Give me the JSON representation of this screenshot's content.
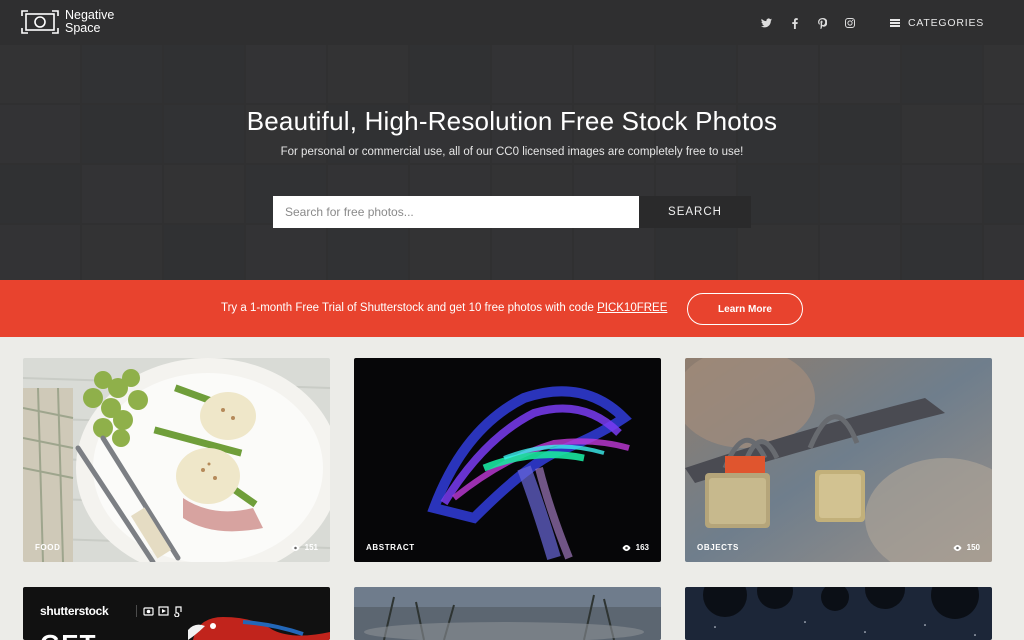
{
  "header": {
    "logo_line1": "Negative",
    "logo_line2": "Space",
    "social_icons": [
      "twitter-icon",
      "facebook-icon",
      "pinterest-icon",
      "instagram-icon"
    ],
    "categories_label": "CATEGORIES"
  },
  "hero": {
    "title": "Beautiful, High-Resolution Free Stock Photos",
    "subtitle": "For personal or commercial use, all of our CC0 licensed images are completely free to use!",
    "search_placeholder": "Search for free photos...",
    "search_button": "SEARCH"
  },
  "promo": {
    "text": "Try a 1-month Free Trial of Shutterstock and get 10 free photos with code ",
    "code": "PICK10FREE",
    "button": "Learn More",
    "background_color": "#e8432e"
  },
  "cards": [
    {
      "category": "FOOD",
      "views": "151"
    },
    {
      "category": "ABSTRACT",
      "views": "163"
    },
    {
      "category": "OBJECTS",
      "views": "150"
    }
  ],
  "ad_card": {
    "brand": "shutterstock",
    "headline_partial": "GET"
  }
}
